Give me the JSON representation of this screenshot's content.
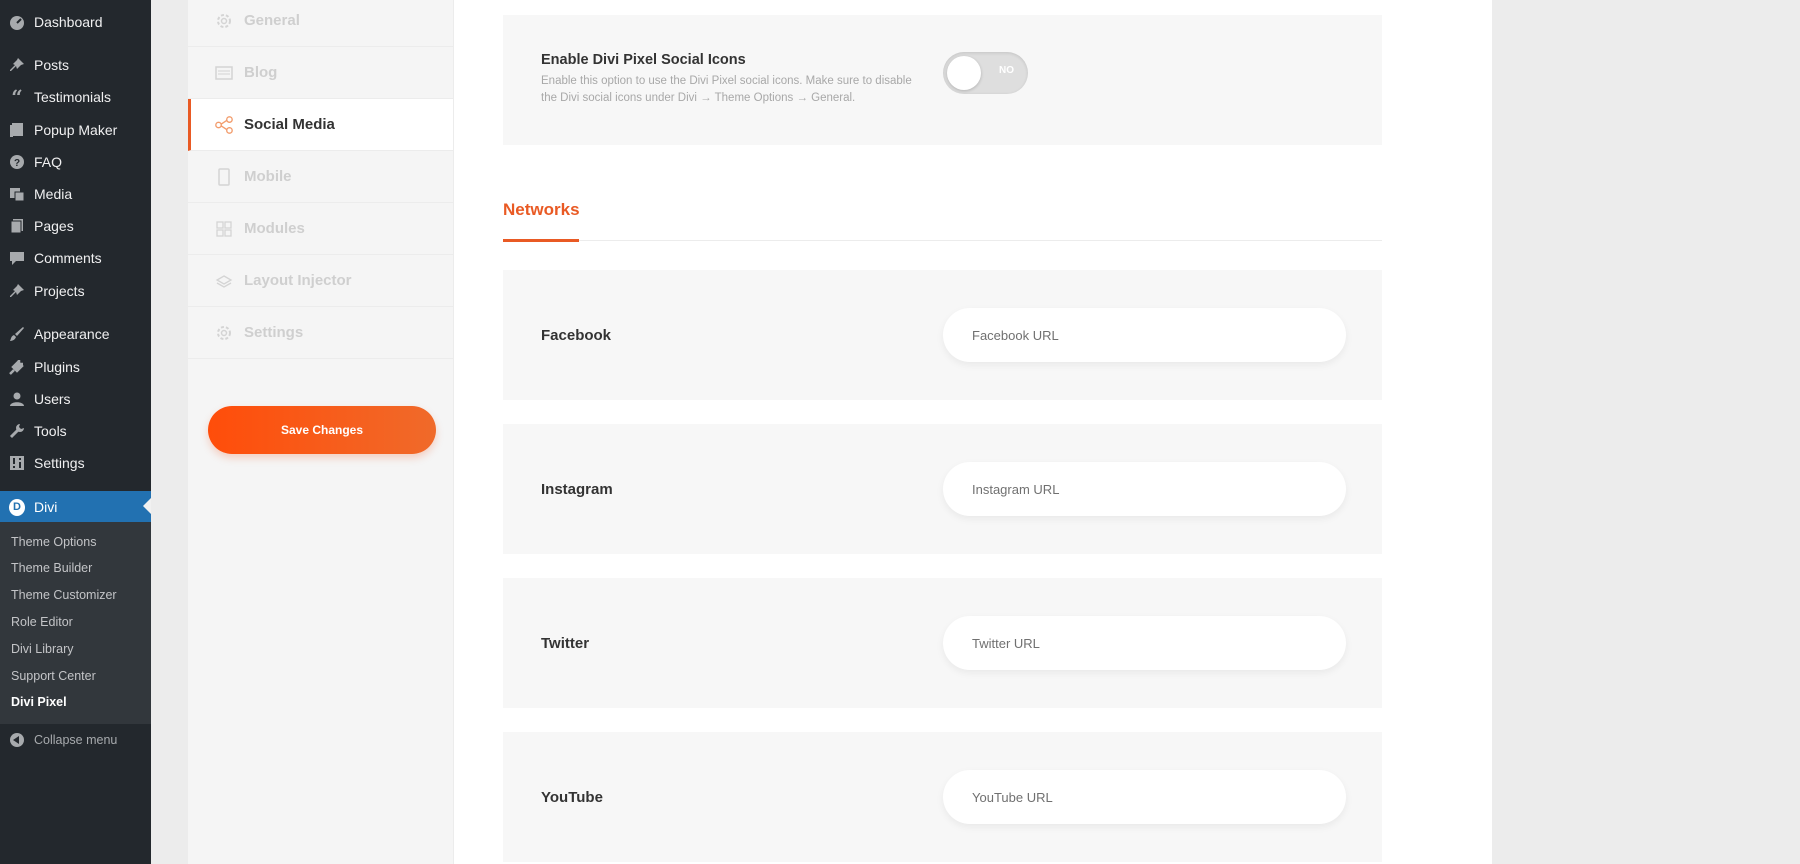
{
  "wp_menu": {
    "items": [
      {
        "label": "Dashboard",
        "icon": "dashboard-icon"
      },
      {
        "label": "Posts",
        "icon": "pin-icon"
      },
      {
        "label": "Testimonials",
        "icon": "quote-icon"
      },
      {
        "label": "Popup Maker",
        "icon": "popup-icon"
      },
      {
        "label": "FAQ",
        "icon": "question-icon"
      },
      {
        "label": "Media",
        "icon": "media-icon"
      },
      {
        "label": "Pages",
        "icon": "pages-icon"
      },
      {
        "label": "Comments",
        "icon": "comment-icon"
      },
      {
        "label": "Projects",
        "icon": "pin-icon"
      },
      {
        "label": "Appearance",
        "icon": "brush-icon"
      },
      {
        "label": "Plugins",
        "icon": "plug-icon"
      },
      {
        "label": "Users",
        "icon": "user-icon"
      },
      {
        "label": "Tools",
        "icon": "wrench-icon"
      },
      {
        "label": "Settings",
        "icon": "settings-icon"
      },
      {
        "label": "Divi",
        "icon": "divi-logo-icon"
      }
    ],
    "submenu": [
      "Theme Options",
      "Theme Builder",
      "Theme Customizer",
      "Role Editor",
      "Divi Library",
      "Support Center",
      "Divi Pixel"
    ],
    "collapse_label": "Collapse menu"
  },
  "tabs": [
    {
      "label": "General",
      "icon": "gear-icon"
    },
    {
      "label": "Blog",
      "icon": "blog-icon"
    },
    {
      "label": "Social Media",
      "icon": "share-icon"
    },
    {
      "label": "Mobile",
      "icon": "mobile-icon"
    },
    {
      "label": "Modules",
      "icon": "modules-icon"
    },
    {
      "label": "Layout Injector",
      "icon": "layers-icon"
    },
    {
      "label": "Settings",
      "icon": "gear-icon"
    }
  ],
  "save_label": "Save Changes",
  "enable": {
    "label": "Enable Divi Pixel Social Icons",
    "description": "Enable this option to use the Divi Pixel social icons. Make sure to disable the Divi social icons under Divi → Theme Options → General.",
    "toggle_label": "NO"
  },
  "networks": {
    "title": "Networks",
    "items": [
      {
        "label": "Facebook",
        "placeholder": "Facebook URL"
      },
      {
        "label": "Instagram",
        "placeholder": "Instagram URL"
      },
      {
        "label": "Twitter",
        "placeholder": "Twitter URL"
      },
      {
        "label": "YouTube",
        "placeholder": "YouTube URL"
      }
    ]
  },
  "colors": {
    "accent": "#e95a24",
    "wp_active": "#2271b1",
    "wp_sidebar": "#23282d"
  }
}
